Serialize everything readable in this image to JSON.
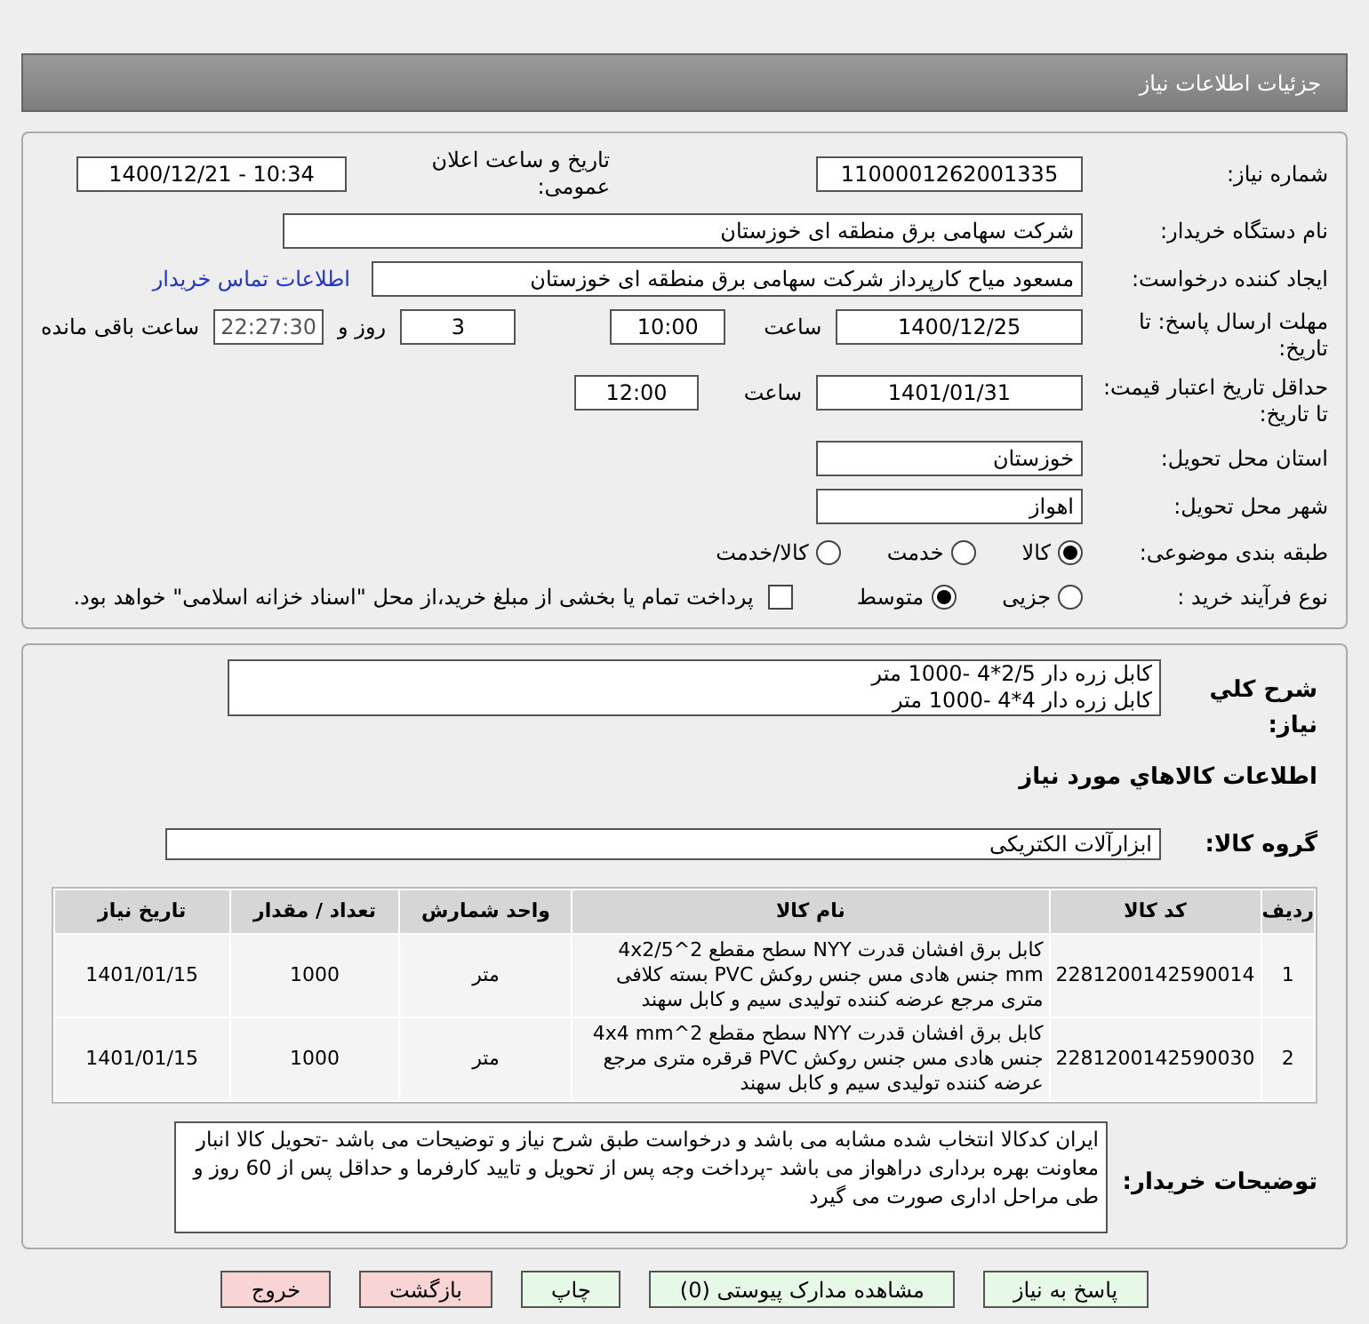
{
  "header": {
    "title": "جزئیات اطلاعات نیاز"
  },
  "need_number": {
    "label": "شماره نیاز:",
    "value": "1100001262001335"
  },
  "announce": {
    "label": "تاریخ و ساعت اعلان عمومی:",
    "value": "1400/12/21 - 10:34"
  },
  "buyer": {
    "label": "نام دستگاه خریدار:",
    "value": "شرکت سهامی برق منطقه ای خوزستان"
  },
  "requester": {
    "label": "ایجاد کننده درخواست:",
    "value": "مسعود میاح کارپرداز شرکت سهامی برق منطقه ای خوزستان",
    "link": "اطلاعات تماس خریدار"
  },
  "deadline": {
    "label": "مهلت ارسال پاسخ: تا تاریخ:",
    "date": "1400/12/25",
    "time_label": "ساعت",
    "time": "10:00",
    "days": "3",
    "days_label": "روز و",
    "remaining": "22:27:30",
    "remaining_label": "ساعت باقی مانده"
  },
  "validity": {
    "label": "حداقل تاریخ اعتبار قیمت: تا تاریخ:",
    "date": "1401/01/31",
    "time_label": "ساعت",
    "time": "12:00"
  },
  "province": {
    "label": "استان محل تحویل:",
    "value": "خوزستان"
  },
  "city": {
    "label": "شهر محل تحویل:",
    "value": "اهواز"
  },
  "category": {
    "label": "طبقه بندی موضوعی:",
    "options": [
      {
        "label": "کالا",
        "selected": true
      },
      {
        "label": "خدمت",
        "selected": false
      },
      {
        "label": "کالا/خدمت",
        "selected": false
      }
    ]
  },
  "process": {
    "label": "نوع فرآیند خرید :",
    "options": [
      {
        "label": "جزیی",
        "selected": false
      },
      {
        "label": "متوسط",
        "selected": true
      }
    ],
    "payment": {
      "checked": false,
      "label": "پرداخت تمام یا بخشی از مبلغ خرید،از محل \"اسناد خزانه اسلامی\" خواهد بود."
    }
  },
  "description": {
    "label": "شرح کلي نياز:",
    "lines": [
      "کابل زره دار 2/5*4 -1000 متر",
      "کابل زره دار 4*4 -1000 متر"
    ]
  },
  "goods_title": "اطلاعات کالاهاي مورد نياز",
  "goods_group": {
    "label": "گروه کالا:",
    "value": "ابزارآلات الکتریکی"
  },
  "table": {
    "columns": [
      "ردیف",
      "کد کالا",
      "نام کالا",
      "واحد شمارش",
      "تعداد / مقدار",
      "تاریخ نیاز"
    ],
    "rows": [
      [
        "1",
        "2281200142590014",
        "کابل برق افشان قدرت NYY سطح مقطع 2^4x2/5 mm جنس هادی مس جنس روکش PVC بسته کلافی متری مرجع عرضه کننده تولیدی سیم و کابل سهند",
        "متر",
        "1000",
        "1401/01/15"
      ],
      [
        "2",
        "2281200142590030",
        "کابل برق افشان قدرت NYY سطح مقطع 2^4x4 mm جنس هادی مس جنس روکش PVC قرقره متری مرجع عرضه کننده تولیدی سیم و کابل سهند",
        "متر",
        "1000",
        "1401/01/15"
      ]
    ]
  },
  "buyer_notes": {
    "label": "توضیحات خریدار:",
    "value": "ایران کدکالا انتخاب شده مشابه می باشد و درخواست طبق شرح نیاز و توضیحات می باشد -تحویل کالا انبار معاونت بهره برداری دراهواز می باشد -پرداخت وجه پس از تحویل و تایید کارفرما و حداقل پس از 60 روز و طی مراحل اداری صورت می گیرد"
  },
  "buttons": [
    {
      "label": "پاسخ به نیاز",
      "kind": "action"
    },
    {
      "label": "مشاهده مدارک پیوستی (0)",
      "kind": "action"
    },
    {
      "label": "چاپ",
      "kind": "action"
    },
    {
      "label": "بازگشت",
      "kind": "exit"
    },
    {
      "label": "خروج",
      "kind": "exit"
    }
  ]
}
